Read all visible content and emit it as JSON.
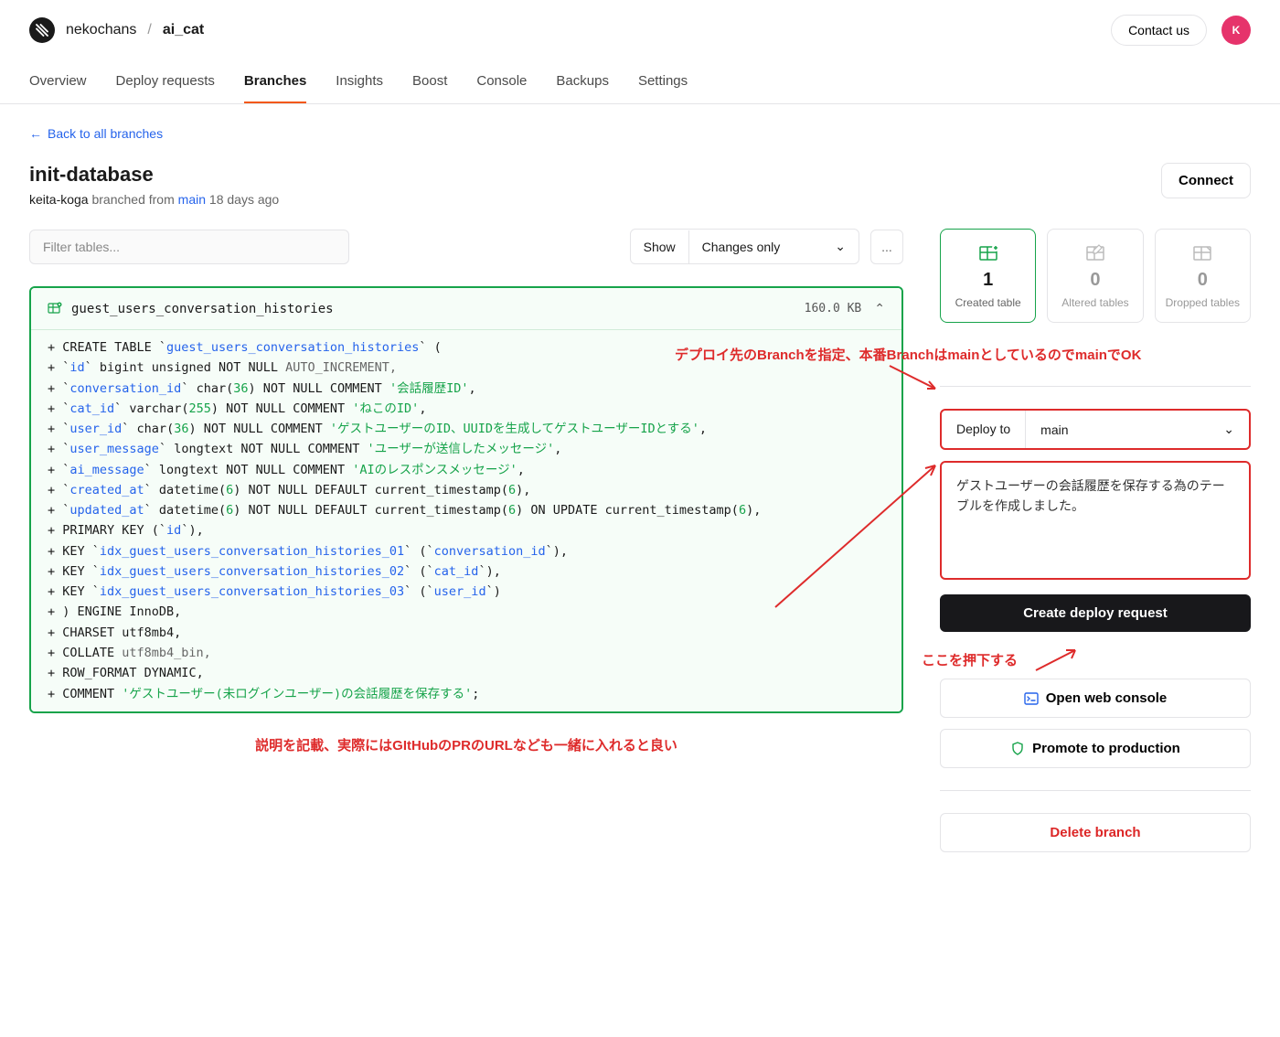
{
  "header": {
    "org": "nekochans",
    "db": "ai_cat",
    "contact": "Contact us",
    "avatar_initial": "K"
  },
  "tabs": [
    "Overview",
    "Deploy requests",
    "Branches",
    "Insights",
    "Boost",
    "Console",
    "Backups",
    "Settings"
  ],
  "active_tab": 2,
  "backlink": "Back to all branches",
  "branch": {
    "name": "init-database",
    "user": "keita-koga",
    "branched_from_text": " branched from ",
    "parent": "main",
    "age": "18 days ago"
  },
  "connect": "Connect",
  "filter_placeholder": "Filter tables...",
  "show": {
    "label": "Show",
    "value": "Changes only"
  },
  "more": "...",
  "diff": {
    "table": "guest_users_conversation_histories",
    "size": "160.0 KB"
  },
  "diff_lines": [
    [
      [
        "+ CREATE TABLE `",
        ""
      ],
      [
        "guest_users_conversation_histories",
        "i"
      ],
      [
        "` (",
        ""
      ]
    ],
    [
      [
        "+ `",
        ""
      ],
      [
        "id",
        "i"
      ],
      [
        "` bigint unsigned ",
        ""
      ],
      [
        "NOT NULL",
        "k"
      ],
      [
        " AUTO_INCREMENT,",
        "c"
      ]
    ],
    [
      [
        "+ `",
        ""
      ],
      [
        "conversation_id",
        "i"
      ],
      [
        "` char(",
        ""
      ],
      [
        "36",
        "n"
      ],
      [
        ") ",
        ""
      ],
      [
        "NOT NULL",
        "k"
      ],
      [
        " COMMENT ",
        ""
      ],
      [
        "'会話履歴ID'",
        "s"
      ],
      [
        ",",
        ""
      ]
    ],
    [
      [
        "+ `",
        ""
      ],
      [
        "cat_id",
        "i"
      ],
      [
        "` varchar(",
        ""
      ],
      [
        "255",
        "n"
      ],
      [
        ") ",
        ""
      ],
      [
        "NOT NULL",
        "k"
      ],
      [
        " COMMENT ",
        ""
      ],
      [
        "'ねこのID'",
        "s"
      ],
      [
        ",",
        ""
      ]
    ],
    [
      [
        "+ `",
        ""
      ],
      [
        "user_id",
        "i"
      ],
      [
        "` char(",
        ""
      ],
      [
        "36",
        "n"
      ],
      [
        ") ",
        ""
      ],
      [
        "NOT NULL",
        "k"
      ],
      [
        " COMMENT ",
        ""
      ],
      [
        "'ゲストユーザーのID、UUIDを生成してゲストユーザーIDとする'",
        "s"
      ],
      [
        ",",
        ""
      ]
    ],
    [
      [
        "+ `",
        ""
      ],
      [
        "user_message",
        "i"
      ],
      [
        "` longtext ",
        ""
      ],
      [
        "NOT NULL",
        "k"
      ],
      [
        " COMMENT ",
        ""
      ],
      [
        "'ユーザーが送信したメッセージ'",
        "s"
      ],
      [
        ",",
        ""
      ]
    ],
    [
      [
        "+ `",
        ""
      ],
      [
        "ai_message",
        "i"
      ],
      [
        "` longtext ",
        ""
      ],
      [
        "NOT NULL",
        "k"
      ],
      [
        " COMMENT ",
        ""
      ],
      [
        "'AIのレスポンスメッセージ'",
        "s"
      ],
      [
        ",",
        ""
      ]
    ],
    [
      [
        "+ `",
        ""
      ],
      [
        "created_at",
        "i"
      ],
      [
        "` datetime(",
        ""
      ],
      [
        "6",
        "n"
      ],
      [
        ") ",
        ""
      ],
      [
        "NOT NULL",
        "k"
      ],
      [
        " DEFAULT current_timestamp(",
        ""
      ],
      [
        "6",
        "n"
      ],
      [
        "),",
        ""
      ]
    ],
    [
      [
        "+ `",
        ""
      ],
      [
        "updated_at",
        "i"
      ],
      [
        "` datetime(",
        ""
      ],
      [
        "6",
        "n"
      ],
      [
        ") ",
        ""
      ],
      [
        "NOT NULL",
        "k"
      ],
      [
        " DEFAULT current_timestamp(",
        ""
      ],
      [
        "6",
        "n"
      ],
      [
        ") ON UPDATE current_timestamp(",
        ""
      ],
      [
        "6",
        "n"
      ],
      [
        "),",
        ""
      ]
    ],
    [
      [
        "+ PRIMARY KEY (`",
        ""
      ],
      [
        "id",
        "i"
      ],
      [
        "`),",
        ""
      ]
    ],
    [
      [
        "+ KEY `",
        ""
      ],
      [
        "idx_guest_users_conversation_histories_01",
        "i"
      ],
      [
        "` (`",
        ""
      ],
      [
        "conversation_id",
        "i"
      ],
      [
        "`),",
        ""
      ]
    ],
    [
      [
        "+ KEY `",
        ""
      ],
      [
        "idx_guest_users_conversation_histories_02",
        "i"
      ],
      [
        "` (`",
        ""
      ],
      [
        "cat_id",
        "i"
      ],
      [
        "`),",
        ""
      ]
    ],
    [
      [
        "+ KEY `",
        ""
      ],
      [
        "idx_guest_users_conversation_histories_03",
        "i"
      ],
      [
        "` (`",
        ""
      ],
      [
        "user_id",
        "i"
      ],
      [
        "`)",
        ""
      ]
    ],
    [
      [
        "+ ) ENGINE InnoDB,",
        ""
      ]
    ],
    [
      [
        "+ CHARSET utf8mb4,",
        ""
      ]
    ],
    [
      [
        "+ COLLATE ",
        ""
      ],
      [
        "utf8mb4_bin,",
        "c"
      ]
    ],
    [
      [
        "+ ROW_FORMAT ",
        ""
      ],
      [
        "DYNAMIC,",
        "k"
      ]
    ],
    [
      [
        "+ COMMENT ",
        ""
      ],
      [
        "'ゲストユーザー(未ログインユーザー)の会話履歴を保存する'",
        "s"
      ],
      [
        ";",
        ""
      ]
    ]
  ],
  "stats": {
    "created": {
      "num": "1",
      "label": "Created table"
    },
    "altered": {
      "num": "0",
      "label": "Altered tables"
    },
    "dropped": {
      "num": "0",
      "label": "Dropped tables"
    }
  },
  "deploy": {
    "label": "Deploy to",
    "value": "main"
  },
  "description": "ゲストユーザーの会話履歴を保存する為のテーブルを作成しました。",
  "create_deploy": "Create deploy request",
  "open_console": "Open web console",
  "promote": "Promote to production",
  "delete_branch": "Delete branch",
  "annotations": {
    "deploy_to": "デプロイ先のBranchを指定、本番BranchはmainとしているのでmainでOK",
    "press": "ここを押下する",
    "desc_hint": "説明を記載、実際にはGItHubのPRのURLなども一緒に入れると良い"
  }
}
